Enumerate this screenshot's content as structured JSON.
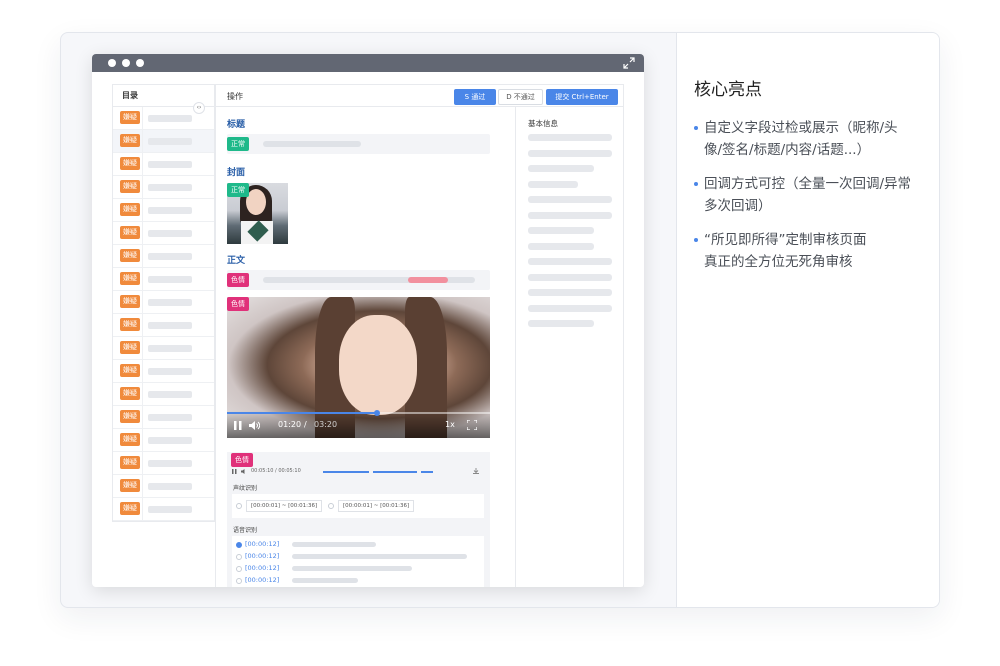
{
  "toc": {
    "title": "目录",
    "toggle": "‹›",
    "items": [
      "嫌疑",
      "嫌疑",
      "嫌疑",
      "嫌疑",
      "嫌疑",
      "嫌疑",
      "嫌疑",
      "嫌疑",
      "嫌疑",
      "嫌疑",
      "嫌疑",
      "嫌疑",
      "嫌疑",
      "嫌疑",
      "嫌疑",
      "嫌疑",
      "嫌疑",
      "嫌疑"
    ]
  },
  "header": {
    "label": "操作",
    "pass_button": "S 通过",
    "fail_button": "D 不通过",
    "submit_button": "提交 Ctrl+Enter"
  },
  "sections": {
    "title_label": "标题",
    "title_status": "正常",
    "cover_label": "封面",
    "cover_status": "正常",
    "body_label": "正文",
    "body_status": "色情",
    "video_status": "色情",
    "audio_status": "色情"
  },
  "video": {
    "current_time": "01:20",
    "separator": "/",
    "duration": "03:20",
    "speed": "1x",
    "progress_fraction": 0.57
  },
  "audio": {
    "time_readout": "00:05:10 / 00:05:10",
    "voiceprint_label": "声纹识别",
    "segments": [
      "[00:00:01] ~ [00:01:36]",
      "[00:00:01] ~ [00:01:36]"
    ],
    "speech_label": "语音识别",
    "timestamps": [
      "[00:00:12]",
      "[00:00:12]",
      "[00:00:12]",
      "[00:00:12]"
    ]
  },
  "info": {
    "title": "基本信息"
  },
  "highlights": {
    "title": "核心亮点",
    "items": [
      "自定义字段过检或展示（昵称/头像/签名/标题/内容/话题...）",
      "回调方式可控（全量一次回调/异常多次回调）",
      "“所见即所得”定制审核页面 真正的全方位无死角审核"
    ]
  },
  "colors": {
    "accent": "#4a86e8",
    "suspect": "#f08a3c",
    "normal": "#1fb98a",
    "porn": "#e0317a",
    "section_title": "#2a5fa8"
  }
}
